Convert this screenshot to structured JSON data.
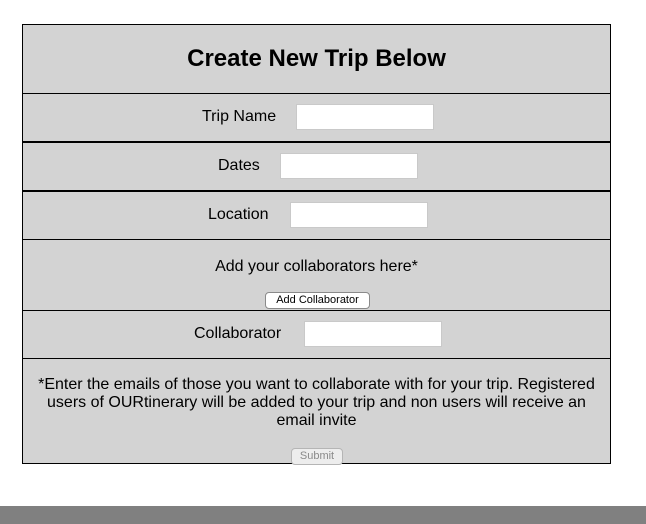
{
  "form": {
    "title": "Create New Trip Below",
    "trip_name": {
      "label": "Trip Name",
      "value": "",
      "placeholder": ""
    },
    "dates": {
      "label": "Dates",
      "value": "",
      "placeholder": ""
    },
    "location": {
      "label": "Location",
      "value": "",
      "placeholder": ""
    },
    "collaborators_prompt": "Add your collaborators here*",
    "add_collaborator_label": "Add Collaborator",
    "collaborator": {
      "label": "Collaborator",
      "value": "",
      "placeholder": ""
    },
    "note": "*Enter the emails of those you want to collaborate with for your trip. Registered users of OURtinerary will be added to your trip and non users will receive an email invite",
    "submit_label": "Submit",
    "submit_disabled": true
  },
  "colors": {
    "card_background": "#d3d3d3",
    "footer_bar": "#808080"
  }
}
